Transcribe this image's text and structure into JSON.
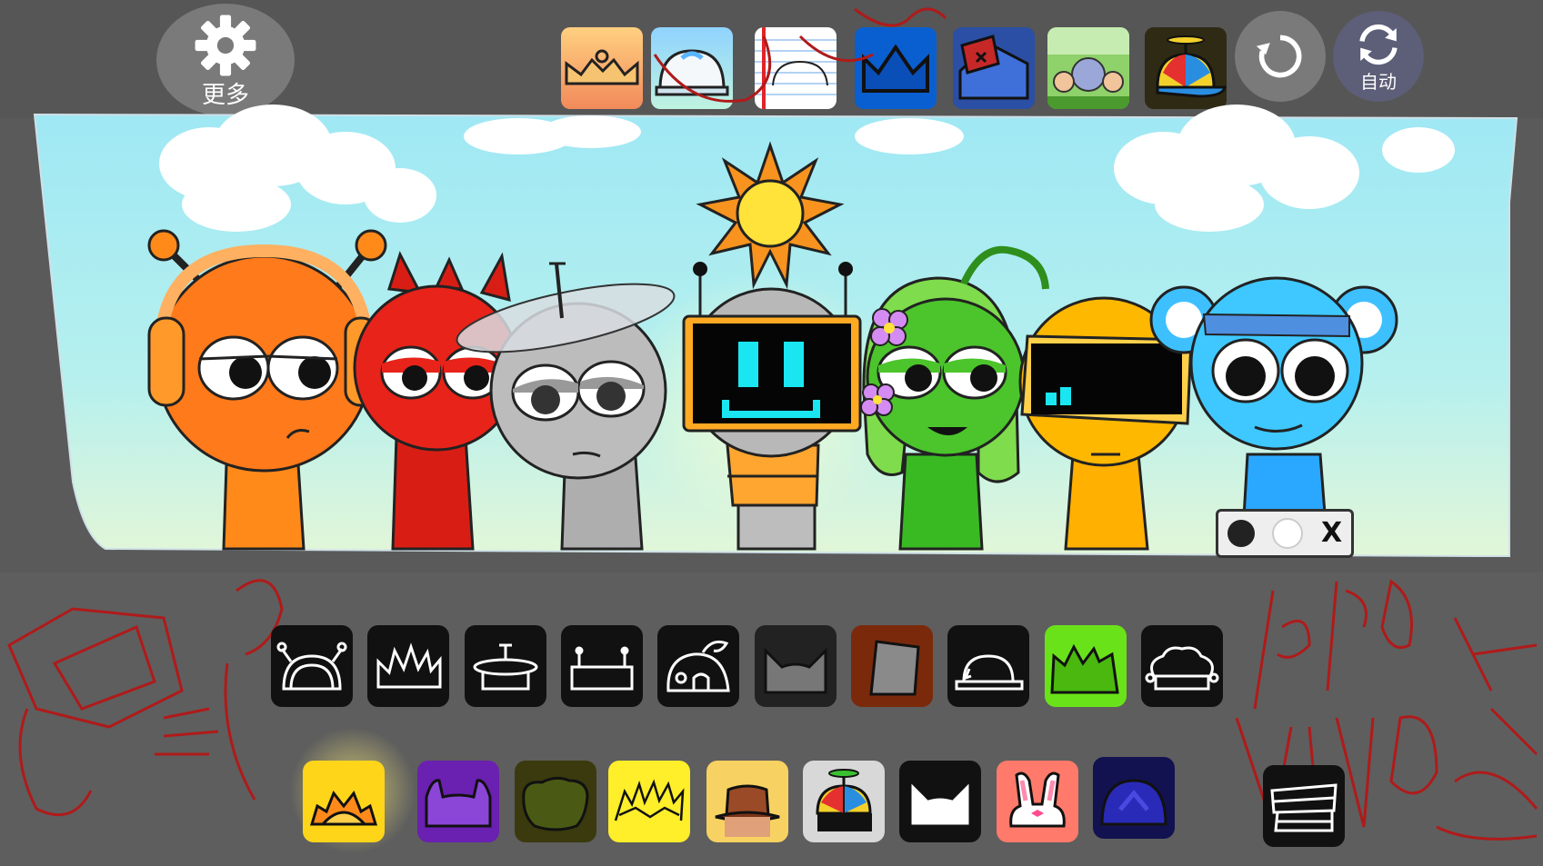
{
  "topbar": {
    "more_label": "更多",
    "auto_label": "自动",
    "thumbnails": [
      {
        "name": "crown-orange-theme"
      },
      {
        "name": "dome-blue-theme"
      },
      {
        "name": "notebook-theme"
      },
      {
        "name": "blue-crown-theme"
      },
      {
        "name": "broken-house-theme"
      },
      {
        "name": "forest-characters-theme"
      },
      {
        "name": "propeller-cap-theme"
      }
    ]
  },
  "stage": {
    "characters": [
      {
        "name": "orange-headphones",
        "color": "#ff7a1a"
      },
      {
        "name": "red-devil",
        "color": "#e8231a"
      },
      {
        "name": "gray-satellite",
        "color": "#b8b8b8"
      },
      {
        "name": "robot-screen",
        "color": "#ffa030"
      },
      {
        "name": "green-vines",
        "color": "#3fc32a"
      },
      {
        "name": "yellow-visor",
        "color": "#ffb400"
      },
      {
        "name": "blue-bear-beanie",
        "color": "#3ec8ff"
      }
    ],
    "mini_bar_close": "X"
  },
  "palette": {
    "row1": [
      "antenna-ears",
      "spiky-crown",
      "satellite-dish",
      "robot-antenna",
      "tree-mushroom",
      "cat-ears",
      "gray-bucket",
      "hard-hat",
      "green-spikes",
      "chef-hat"
    ],
    "row2": [
      "sun-crown",
      "purple-horns",
      "bush-hair",
      "lightning-crown",
      "brown-fedora",
      "propeller-cap",
      "white-cat-ears",
      "pink-bunny-ears",
      "blue-dome"
    ],
    "extra": "striped-box"
  },
  "colors": {
    "background": "#5a5a5a",
    "sky_top": "#a8ecf5",
    "sky_bottom": "#d7f5e6",
    "scribble": "#b01a1a"
  }
}
